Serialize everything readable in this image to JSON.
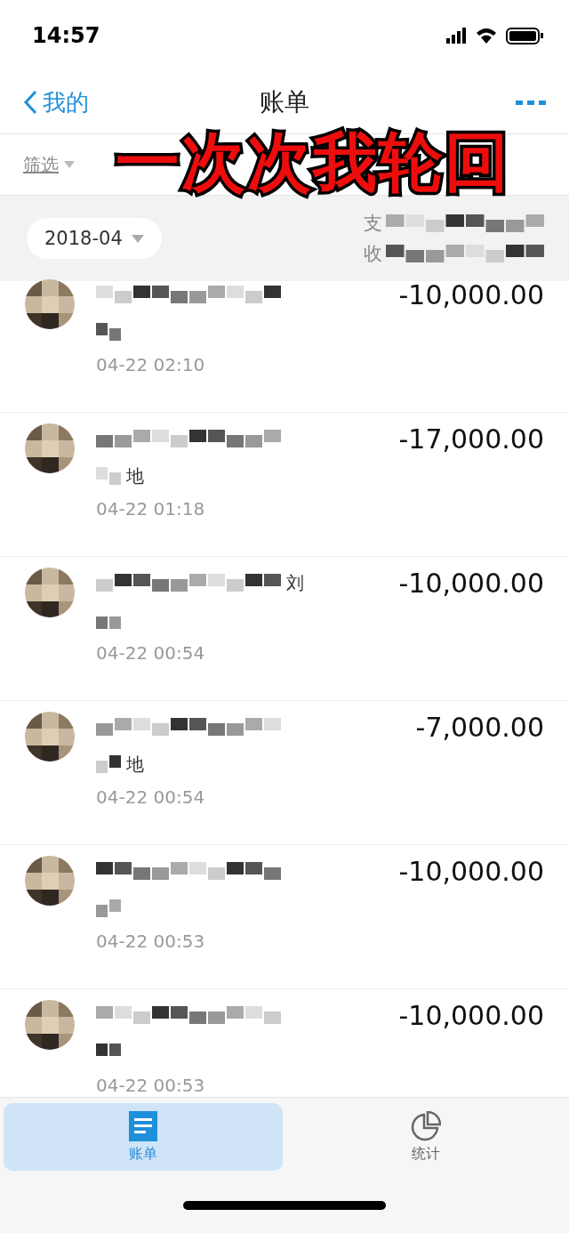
{
  "status_bar": {
    "time": "14:57"
  },
  "nav": {
    "back_label": "我的",
    "title": "账单"
  },
  "caption": "一次次我轮回",
  "filters": [
    {
      "label": "筛选"
    }
  ],
  "month_header": {
    "month": "2018-04",
    "expense_label": "支",
    "income_label": "收"
  },
  "transactions": [
    {
      "amount": "-10,000.00",
      "time": "04-22  02:10"
    },
    {
      "amount": "-17,000.00",
      "time": "04-22  01:18",
      "note": "地"
    },
    {
      "amount": "-10,000.00",
      "time": "04-22  00:54",
      "note": "刘"
    },
    {
      "amount": "-7,000.00",
      "time": "04-22  00:54",
      "note": "地"
    },
    {
      "amount": "-10,000.00",
      "time": "04-22  00:53"
    },
    {
      "amount": "-10,000.00",
      "time": "04-22  00:53"
    }
  ],
  "tabs": [
    {
      "label": "账单",
      "selected": true
    },
    {
      "label": "统计",
      "selected": false
    }
  ]
}
